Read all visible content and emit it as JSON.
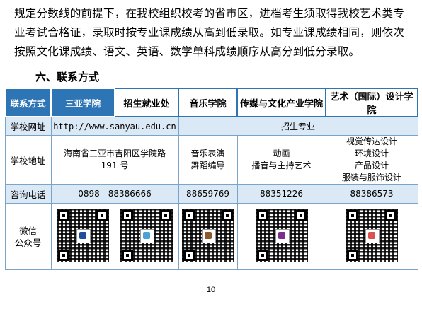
{
  "paragraph": {
    "lines": [
      "规定分数线的前提下，在我校组织校考的省市区，进档考生须取得我校艺术类专",
      "业考试合格证，录取时按专业课成绩从高到低录取。如专业课成绩相同，则依次",
      "按照文化课成绩、语文、英语、数学单科成绩顺序从高分到低分录取。"
    ]
  },
  "section_title": "六、联系方式",
  "table": {
    "headers": [
      "联系方式",
      "三亚学院",
      "招生就业处",
      "音乐学院",
      "传媒与文化产业学院",
      "艺术（国际）设计学院"
    ],
    "website": {
      "label": "学校网址",
      "url": "http://www.sanyau.edu.cn",
      "majors_header": "招生专业"
    },
    "address": {
      "label": "学校地址",
      "lines": [
        "海南省三亚市吉阳区学院路",
        "191 号"
      ],
      "music": [
        "音乐表演",
        "舞蹈编导"
      ],
      "media": [
        "动画",
        "播音与主持艺术"
      ],
      "design": [
        "视觉传达设计",
        "环境设计",
        "产品设计",
        "服装与服饰设计"
      ]
    },
    "phone": {
      "label": "咨询电话",
      "main": "0898—88386666",
      "music": "88659769",
      "media": "88351226",
      "design": "88386573"
    },
    "wechat": {
      "label_lines": [
        "微信",
        "公众号"
      ]
    }
  },
  "colors": {
    "header_blue": "#2e75b6",
    "row_tint": "#dbe8f5",
    "border": "#7aa5c9"
  },
  "page_number": "10"
}
